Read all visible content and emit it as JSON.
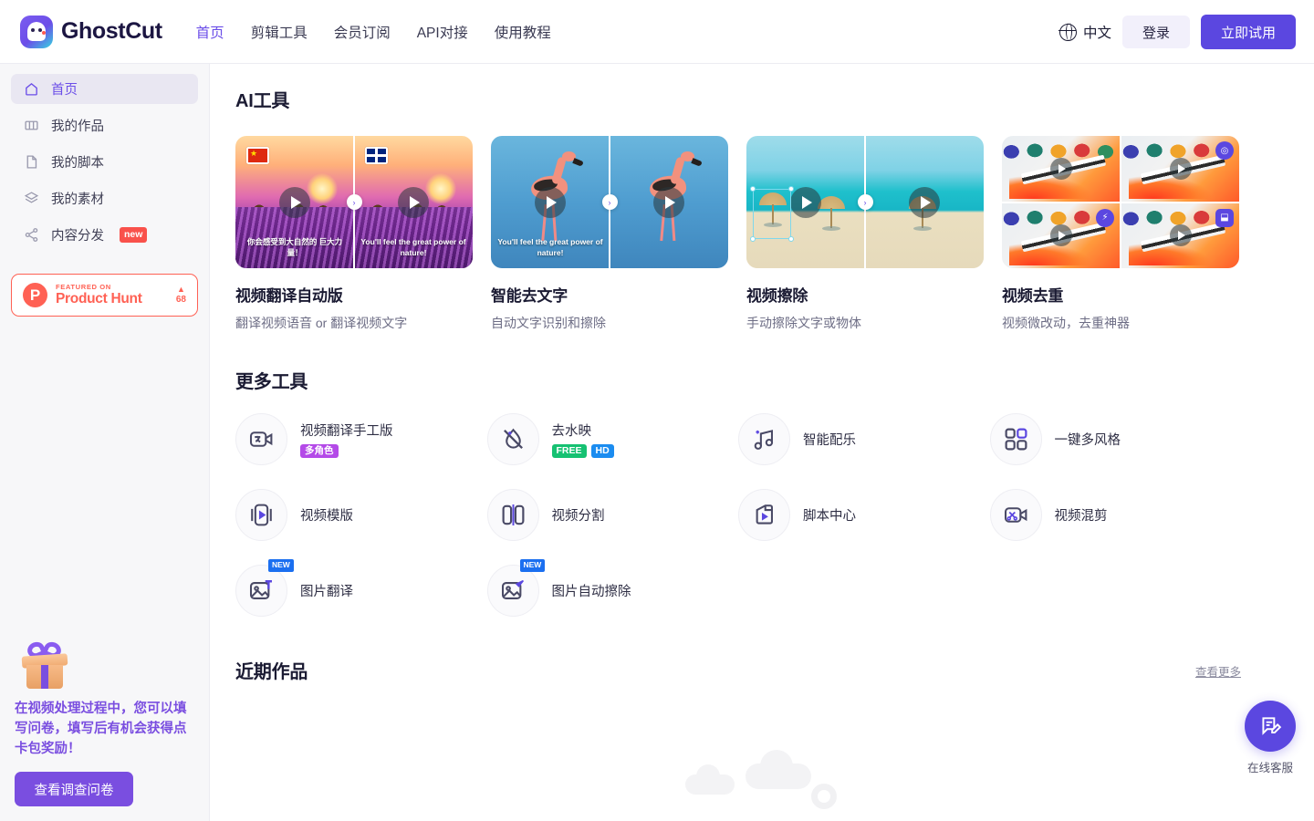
{
  "header": {
    "brand": "GhostCut",
    "logo_icon": "ghost-logo-icon",
    "nav": [
      {
        "label": "首页",
        "active": true
      },
      {
        "label": "剪辑工具",
        "active": false
      },
      {
        "label": "会员订阅",
        "active": false
      },
      {
        "label": "API对接",
        "active": false
      },
      {
        "label": "使用教程",
        "active": false
      }
    ],
    "language": "中文",
    "language_icon": "globe-icon",
    "login_label": "登录",
    "trial_label": "立即试用"
  },
  "sidebar": {
    "items": [
      {
        "label": "首页",
        "icon": "home-icon",
        "active": true,
        "badge": ""
      },
      {
        "label": "我的作品",
        "icon": "grid-icon",
        "active": false,
        "badge": ""
      },
      {
        "label": "我的脚本",
        "icon": "document-icon",
        "active": false,
        "badge": ""
      },
      {
        "label": "我的素材",
        "icon": "layers-icon",
        "active": false,
        "badge": ""
      },
      {
        "label": "内容分发",
        "icon": "share-icon",
        "active": false,
        "badge": "new"
      }
    ],
    "product_hunt": {
      "mark": "P",
      "featured_on": "FEATURED ON",
      "title": "Product Hunt",
      "arrow": "▲",
      "votes": "68"
    },
    "promo": {
      "icon": "gift-icon",
      "text": "在视频处理过程中，您可以填写问卷，填写后有机会获得点卡包奖励！",
      "button_label": "查看调查问卷"
    }
  },
  "main": {
    "ai_section_title": "AI工具",
    "ai_tools": [
      {
        "title": "视频翻译自动版",
        "desc": "翻译视频语音 or 翻译视频文字",
        "thumb_type": "compare-lavender",
        "left_flag": "flag-cn",
        "right_flag": "flag-uk",
        "left_caption": "你会感受到大自然的 巨大力量！",
        "right_caption": "You'll feel the great power of nature!"
      },
      {
        "title": "智能去文字",
        "desc": "自动文字识别和擦除",
        "thumb_type": "compare-flamingo",
        "left_caption": "You'll feel the great power of nature!",
        "right_caption": ""
      },
      {
        "title": "视频擦除",
        "desc": "手动擦除文字或物体",
        "thumb_type": "compare-beach",
        "left_caption": "",
        "right_caption": ""
      },
      {
        "title": "视频去重",
        "desc": "视频微改动，去重神器",
        "thumb_type": "quad-paint",
        "quad_badges": [
          "",
          "◎",
          "⚡",
          "⬓"
        ]
      }
    ],
    "more_section_title": "更多工具",
    "more_tools": [
      {
        "label": "视频翻译手工版",
        "icon": "video-translate-icon",
        "badges": [
          {
            "text": "多角色",
            "style": "purple"
          }
        ],
        "new": false
      },
      {
        "label": "去水映",
        "icon": "watermark-remove-icon",
        "badges": [
          {
            "text": "FREE",
            "style": "free"
          },
          {
            "text": "HD",
            "style": "hd"
          }
        ],
        "new": false
      },
      {
        "label": "智能配乐",
        "icon": "music-note-icon",
        "badges": [],
        "new": false
      },
      {
        "label": "一键多风格",
        "icon": "grid-four-icon",
        "badges": [],
        "new": false
      },
      {
        "label": "视频模版",
        "icon": "video-template-icon",
        "badges": [],
        "new": false
      },
      {
        "label": "视频分割",
        "icon": "video-split-icon",
        "badges": [],
        "new": false
      },
      {
        "label": "脚本中心",
        "icon": "script-center-icon",
        "badges": [],
        "new": false
      },
      {
        "label": "视频混剪",
        "icon": "video-mix-icon",
        "badges": [],
        "new": false
      },
      {
        "label": "图片翻译",
        "icon": "image-translate-icon",
        "badges": [],
        "new": true,
        "new_label": "NEW"
      },
      {
        "label": "图片自动擦除",
        "icon": "image-erase-icon",
        "badges": [],
        "new": true,
        "new_label": "NEW"
      }
    ],
    "recent_section_title": "近期作品",
    "recent_more_label": "查看更多"
  },
  "support": {
    "label": "在线客服",
    "icon": "chat-edit-icon"
  },
  "colors": {
    "accent": "#5b47e0",
    "accent_light": "#6b4ee8",
    "promo_purple": "#7a4ee0",
    "product_hunt": "#ff6154",
    "badge_new_red": "#f9514b",
    "badge_new_blue": "#1b6ff0",
    "badge_free": "#16c172",
    "badge_hd": "#1b8cf0",
    "badge_role": "#b44ae8"
  }
}
